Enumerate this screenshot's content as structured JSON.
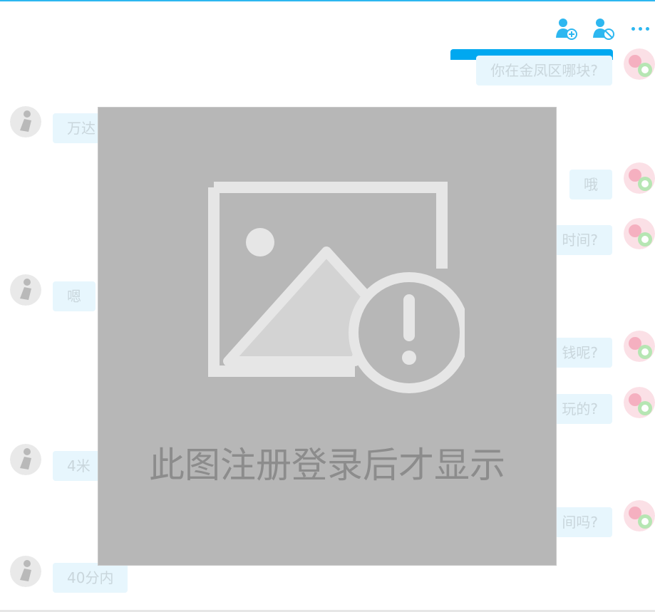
{
  "toolbar": {
    "add_friend_icon": "add-user-icon",
    "block_icon": "block-user-icon",
    "more_icon": "more-dots-icon"
  },
  "messages": [
    {
      "side": "right",
      "text": "你在金凤区哪块?"
    },
    {
      "side": "left",
      "text": "万达"
    },
    {
      "side": "right",
      "text": "哦"
    },
    {
      "side": "right",
      "text": "时间?"
    },
    {
      "side": "left",
      "text": "嗯"
    },
    {
      "side": "right",
      "text": "钱呢?"
    },
    {
      "side": "right",
      "text": "玩的?"
    },
    {
      "side": "left",
      "text": "4米"
    },
    {
      "side": "right",
      "text": "间吗?"
    },
    {
      "side": "left",
      "text": "40分内"
    }
  ],
  "overlay": {
    "caption": "此图注册登录后才显示",
    "icon": "broken-image-icon"
  },
  "colors": {
    "accent": "#2db7f0",
    "bubble": "#e7f6fd",
    "overlay_bg": "#b7b7b7"
  }
}
